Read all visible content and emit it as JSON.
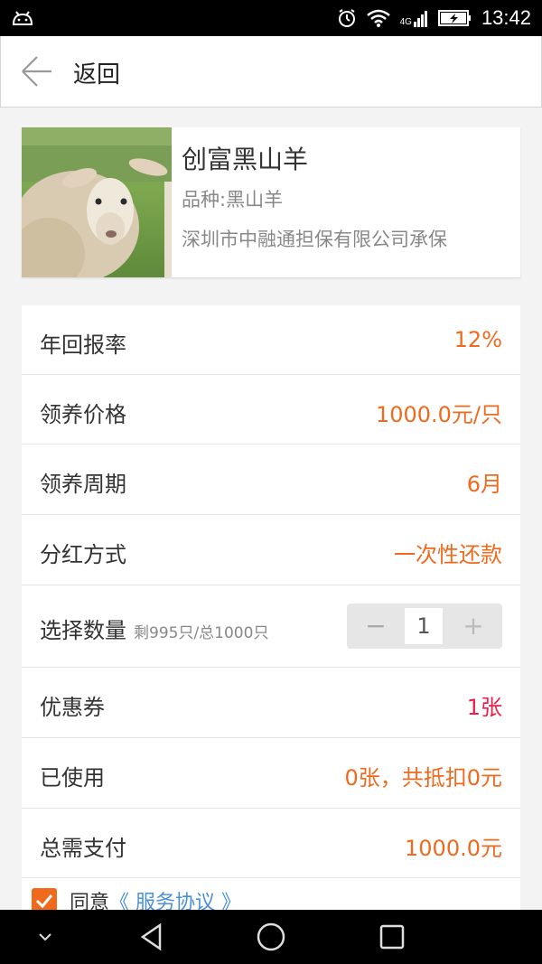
{
  "status_bar": {
    "network": "4G",
    "time": "13:42"
  },
  "nav": {
    "back_label": "返回"
  },
  "product": {
    "name": "创富黑山羊",
    "breed": "品种:黑山羊",
    "guarantor": "深圳市中融通担保有限公司承保",
    "image_icon": "sheep-photo"
  },
  "details": {
    "annual_return": {
      "label": "年回报率",
      "value": "12%"
    },
    "price": {
      "label": "领养价格",
      "value": "1000.0元/只"
    },
    "period": {
      "label": "领养周期",
      "value": "6月"
    },
    "dividend": {
      "label": "分红方式",
      "value": "一次性还款"
    },
    "quantity": {
      "label": "选择数量",
      "stock_note": "剩995只/总1000只",
      "minus": "−",
      "value": "1",
      "plus": "+"
    },
    "coupon": {
      "label": "优惠券",
      "value": "1张"
    },
    "used": {
      "label": "已使用",
      "value": "0张，共抵扣0元"
    },
    "total": {
      "label": "总需支付",
      "value": "1000.0元"
    }
  },
  "agreement": {
    "checked": true,
    "text": "同意",
    "link": "《 服务协议 》"
  },
  "colors": {
    "accent": "#f06a1e",
    "coupon": "#e8204a",
    "link": "#4a90d9"
  }
}
